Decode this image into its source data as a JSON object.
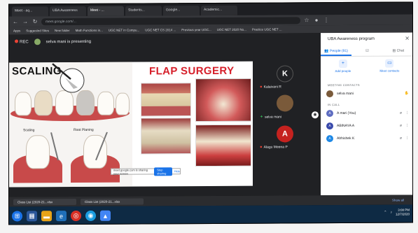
{
  "browser": {
    "tabs": [
      "Meet - aq...",
      "UBA Awareness",
      "Meet - ...",
      "Students...",
      "Google...",
      "Academic..."
    ],
    "active_tab": "Meet - ...",
    "url": "meet.google.com/...",
    "bookmarks": [
      "Apps",
      "Suggested Sites",
      "New folder",
      "Math Functions in...",
      "UGC NET in Compu...",
      "UGC NET CS 2014 ...",
      "Previous year UGC...",
      "UGC NET 2020 No...",
      "Practice UGC NET ..."
    ]
  },
  "meet": {
    "rec_label": "REC",
    "presenting_text": "selva mani is presenting",
    "slide": {
      "title_left": "SCALING",
      "title_right": "FLAP SURGERY",
      "label_scaling": "Scaling",
      "label_root_planing": "Root Planing",
      "share_banner": "meet.google.com is sharing your screen",
      "stop_sharing": "Stop sharing",
      "hide": "Hide"
    },
    "participants": [
      {
        "initial": "K",
        "name": "Kalaivani R",
        "color": "#202124",
        "muted": true
      },
      {
        "initial": "",
        "name": "selva mani",
        "color": "#7a5a3a",
        "muted": false
      },
      {
        "initial": "A",
        "name": "Alagu Meena P",
        "color": "#c5221f",
        "muted": true
      }
    ]
  },
  "panel": {
    "title": "UBA Awareness program",
    "tabs": [
      "People (91)",
      "",
      "Chat"
    ],
    "actions": [
      {
        "label": "Add people",
        "icon": "person-add-icon"
      },
      {
        "label": "Meet contacts",
        "icon": "contacts-icon"
      }
    ],
    "section_contributors": "MEETING CONTACTS",
    "contributor": "selva mani",
    "section_in_call": "IN CALL",
    "people": [
      {
        "initial": "A",
        "name": "A mari (You)",
        "color": "#5c6bc0"
      },
      {
        "initial": "A",
        "name": "ABINAYA A",
        "color": "#3949ab"
      },
      {
        "initial": "A",
        "name": "Abhishek K",
        "color": "#1e88e5"
      }
    ]
  },
  "downloads": {
    "items": [
      "Class List (2020-21...xlsx",
      "Class List (2020-21...xlsx"
    ],
    "show_all": "Show all"
  },
  "taskbar": {
    "time": "3:08 PM",
    "date": "12/7/2020"
  }
}
